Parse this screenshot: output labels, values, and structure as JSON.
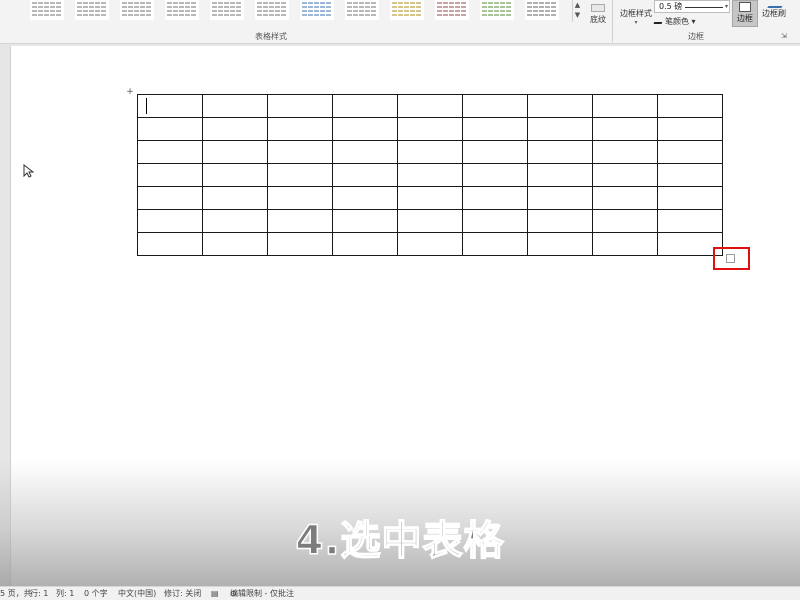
{
  "ribbon": {
    "table_styles_group_label": "表格样式",
    "shading_label": "底纹",
    "border_style_label": "边框样式",
    "pen_weight_value": "0.5 磅",
    "pen_color_label": "笔颜色",
    "borders_label": "边框",
    "border_painter_label": "边框刷",
    "borders_group_label": "边框",
    "gallery_scroll_up": "▲",
    "gallery_scroll_down": "▼"
  },
  "table": {
    "rows": 7,
    "cols": 9,
    "table_move_handle": "+"
  },
  "caption": {
    "text": "4.选中表格"
  },
  "status_bar": {
    "page": "5 页，共",
    "line": "行: 1",
    "column": "列: 1",
    "word_count": "0 个字",
    "language": "中文(中国)",
    "track_changes": "修订: 关闭",
    "edit_mode": "编辑限制 - 仅批注"
  },
  "colors": {
    "highlight": "#e01010",
    "ribbon_bg": "#f3f3f3",
    "page_bg": "#ffffff"
  }
}
